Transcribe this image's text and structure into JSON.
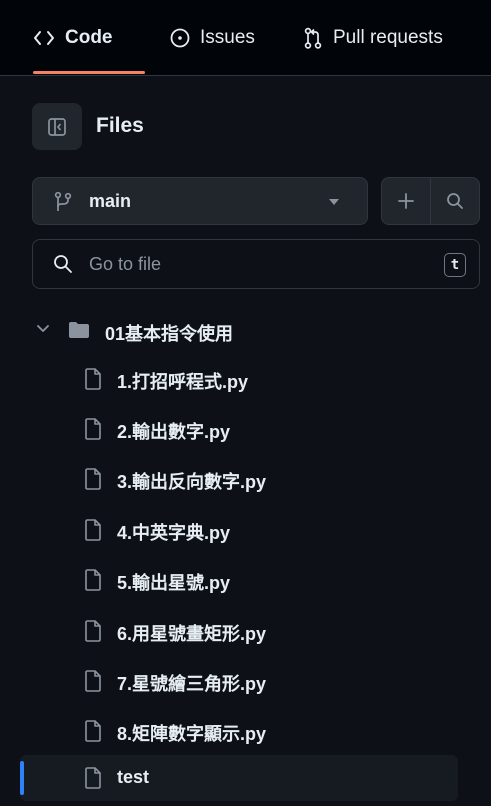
{
  "nav": {
    "tabs": [
      {
        "label": "Code",
        "icon": "code-icon",
        "active": true
      },
      {
        "label": "Issues",
        "icon": "issue-icon"
      },
      {
        "label": "Pull requests",
        "icon": "pull-request-icon"
      }
    ],
    "accent_color": "#f78166"
  },
  "sidebar": {
    "title": "Files",
    "branch": "main",
    "search_placeholder": "Go to file",
    "shortcut_key": "t"
  },
  "tree": {
    "folder": {
      "name": "01基本指令使用",
      "expanded": true
    },
    "files": [
      {
        "name": "1.打招呼程式.py"
      },
      {
        "name": "2.輸出數字.py"
      },
      {
        "name": "3.輸出反向數字.py"
      },
      {
        "name": "4.中英字典.py"
      },
      {
        "name": "5.輸出星號.py"
      },
      {
        "name": "6.用星號畫矩形.py"
      },
      {
        "name": "7.星號繪三角形.py"
      },
      {
        "name": "8.矩陣數字顯示.py"
      },
      {
        "name": "test",
        "selected": true
      }
    ],
    "selection_color": "#2f81f7"
  }
}
